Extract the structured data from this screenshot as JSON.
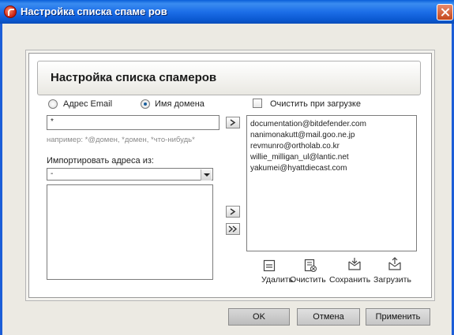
{
  "window": {
    "title": "Настройка списка спаме ров"
  },
  "panel": {
    "title": "Настройка списка спамеров"
  },
  "mode": {
    "option_email": "Адрес Email",
    "option_domain": "Имя домена",
    "selected": "domain"
  },
  "clear_on_load": {
    "label": "Очистить при загрузке",
    "checked": false
  },
  "entry": {
    "value": "*",
    "hint": "например: *@домен, *домен, *что-нибудь*"
  },
  "import": {
    "label": "Импортировать адреса из:",
    "selected": "-"
  },
  "spammers": [
    "documentation@bitdefender.com",
    "nanimonakutt@mail.goo.ne.jp",
    "revmunro@ortholab.co.kr",
    "willie_milligan_ul@lantic.net",
    "yakumei@hyattdiecast.com"
  ],
  "actions": {
    "delete": "Удалить",
    "clear": "Очистить",
    "save": "Сохранить",
    "load": "Загрузить"
  },
  "buttons": {
    "ok": "OK",
    "cancel": "Отмена",
    "apply": "Применить"
  }
}
